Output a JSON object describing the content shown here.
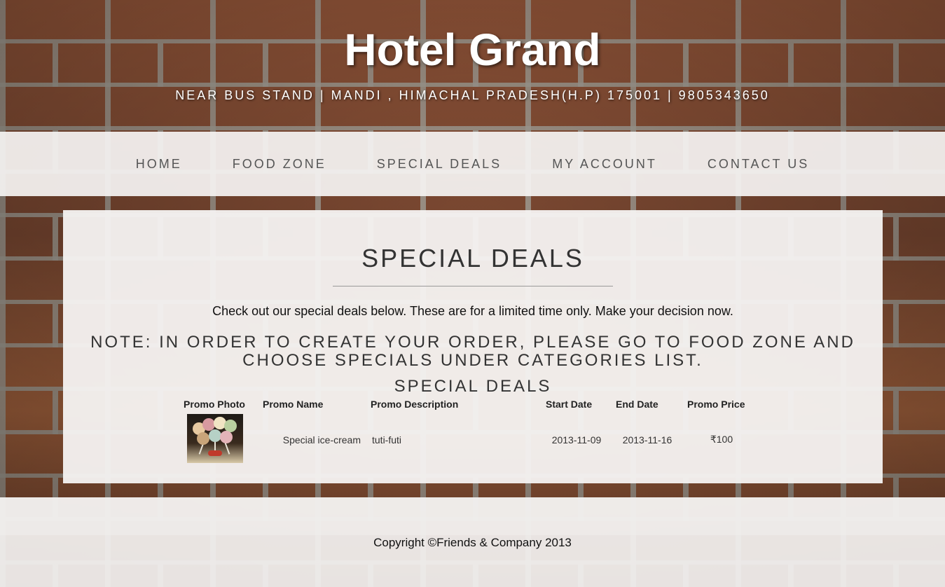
{
  "header": {
    "title": "Hotel Grand",
    "subtitle": "NEAR BUS STAND | MANDI , HIMACHAL PRADESH(H.P) 175001 | 9805343650"
  },
  "nav": {
    "items": [
      "HOME",
      "FOOD ZONE",
      "SPECIAL DEALS",
      "MY ACCOUNT",
      "CONTACT US"
    ]
  },
  "main": {
    "title": "SPECIAL DEALS",
    "intro": "Check out our special deals below. These are for a limited time only. Make your decision now.",
    "note": "NOTE: IN ORDER TO CREATE YOUR ORDER, PLEASE GO TO FOOD ZONE AND CHOOSE SPECIALS UNDER CATEGORIES LIST.",
    "table_title": "SPECIAL DEALS",
    "columns": [
      "Promo Photo",
      "Promo Name",
      "Promo Description",
      "Start Date",
      "End Date",
      "Promo Price"
    ],
    "rows": [
      {
        "photo_icon": "ice-cream-photo",
        "name": "Special ice-cream",
        "description": "tuti-futi",
        "start_date": "2013-11-09",
        "end_date": "2013-11-16",
        "price": "₹100"
      }
    ]
  },
  "footer": {
    "copyright": "Copyright ©Friends & Company 2013"
  }
}
